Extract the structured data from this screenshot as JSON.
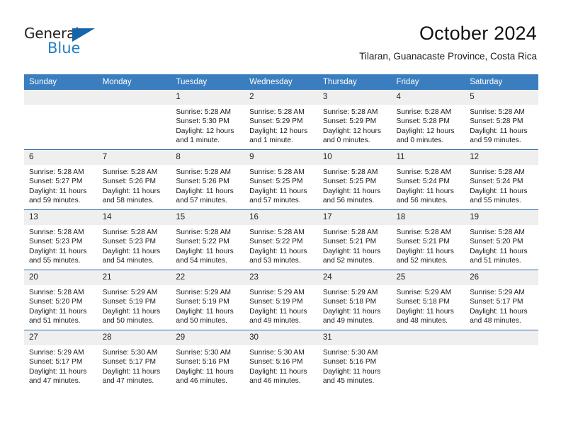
{
  "brand": {
    "name_dark": "General",
    "name_blue": "Blue",
    "accent_color": "#1f7fc4",
    "triangle_color": "#1565a8"
  },
  "header": {
    "title": "October 2024",
    "subtitle": "Tilaran, Guanacaste Province, Costa Rica"
  },
  "calendar": {
    "header_bg": "#3a7ec0",
    "row_border": "#2a68ad",
    "daynum_bg": "#efefef",
    "weekdays": [
      "Sunday",
      "Monday",
      "Tuesday",
      "Wednesday",
      "Thursday",
      "Friday",
      "Saturday"
    ],
    "weeks": [
      [
        {
          "day": "",
          "lines": []
        },
        {
          "day": "",
          "lines": []
        },
        {
          "day": "1",
          "lines": [
            "Sunrise: 5:28 AM",
            "Sunset: 5:30 PM",
            "Daylight: 12 hours",
            "and 1 minute."
          ]
        },
        {
          "day": "2",
          "lines": [
            "Sunrise: 5:28 AM",
            "Sunset: 5:29 PM",
            "Daylight: 12 hours",
            "and 1 minute."
          ]
        },
        {
          "day": "3",
          "lines": [
            "Sunrise: 5:28 AM",
            "Sunset: 5:29 PM",
            "Daylight: 12 hours",
            "and 0 minutes."
          ]
        },
        {
          "day": "4",
          "lines": [
            "Sunrise: 5:28 AM",
            "Sunset: 5:28 PM",
            "Daylight: 12 hours",
            "and 0 minutes."
          ]
        },
        {
          "day": "5",
          "lines": [
            "Sunrise: 5:28 AM",
            "Sunset: 5:28 PM",
            "Daylight: 11 hours",
            "and 59 minutes."
          ]
        }
      ],
      [
        {
          "day": "6",
          "lines": [
            "Sunrise: 5:28 AM",
            "Sunset: 5:27 PM",
            "Daylight: 11 hours",
            "and 59 minutes."
          ]
        },
        {
          "day": "7",
          "lines": [
            "Sunrise: 5:28 AM",
            "Sunset: 5:26 PM",
            "Daylight: 11 hours",
            "and 58 minutes."
          ]
        },
        {
          "day": "8",
          "lines": [
            "Sunrise: 5:28 AM",
            "Sunset: 5:26 PM",
            "Daylight: 11 hours",
            "and 57 minutes."
          ]
        },
        {
          "day": "9",
          "lines": [
            "Sunrise: 5:28 AM",
            "Sunset: 5:25 PM",
            "Daylight: 11 hours",
            "and 57 minutes."
          ]
        },
        {
          "day": "10",
          "lines": [
            "Sunrise: 5:28 AM",
            "Sunset: 5:25 PM",
            "Daylight: 11 hours",
            "and 56 minutes."
          ]
        },
        {
          "day": "11",
          "lines": [
            "Sunrise: 5:28 AM",
            "Sunset: 5:24 PM",
            "Daylight: 11 hours",
            "and 56 minutes."
          ]
        },
        {
          "day": "12",
          "lines": [
            "Sunrise: 5:28 AM",
            "Sunset: 5:24 PM",
            "Daylight: 11 hours",
            "and 55 minutes."
          ]
        }
      ],
      [
        {
          "day": "13",
          "lines": [
            "Sunrise: 5:28 AM",
            "Sunset: 5:23 PM",
            "Daylight: 11 hours",
            "and 55 minutes."
          ]
        },
        {
          "day": "14",
          "lines": [
            "Sunrise: 5:28 AM",
            "Sunset: 5:23 PM",
            "Daylight: 11 hours",
            "and 54 minutes."
          ]
        },
        {
          "day": "15",
          "lines": [
            "Sunrise: 5:28 AM",
            "Sunset: 5:22 PM",
            "Daylight: 11 hours",
            "and 54 minutes."
          ]
        },
        {
          "day": "16",
          "lines": [
            "Sunrise: 5:28 AM",
            "Sunset: 5:22 PM",
            "Daylight: 11 hours",
            "and 53 minutes."
          ]
        },
        {
          "day": "17",
          "lines": [
            "Sunrise: 5:28 AM",
            "Sunset: 5:21 PM",
            "Daylight: 11 hours",
            "and 52 minutes."
          ]
        },
        {
          "day": "18",
          "lines": [
            "Sunrise: 5:28 AM",
            "Sunset: 5:21 PM",
            "Daylight: 11 hours",
            "and 52 minutes."
          ]
        },
        {
          "day": "19",
          "lines": [
            "Sunrise: 5:28 AM",
            "Sunset: 5:20 PM",
            "Daylight: 11 hours",
            "and 51 minutes."
          ]
        }
      ],
      [
        {
          "day": "20",
          "lines": [
            "Sunrise: 5:28 AM",
            "Sunset: 5:20 PM",
            "Daylight: 11 hours",
            "and 51 minutes."
          ]
        },
        {
          "day": "21",
          "lines": [
            "Sunrise: 5:29 AM",
            "Sunset: 5:19 PM",
            "Daylight: 11 hours",
            "and 50 minutes."
          ]
        },
        {
          "day": "22",
          "lines": [
            "Sunrise: 5:29 AM",
            "Sunset: 5:19 PM",
            "Daylight: 11 hours",
            "and 50 minutes."
          ]
        },
        {
          "day": "23",
          "lines": [
            "Sunrise: 5:29 AM",
            "Sunset: 5:19 PM",
            "Daylight: 11 hours",
            "and 49 minutes."
          ]
        },
        {
          "day": "24",
          "lines": [
            "Sunrise: 5:29 AM",
            "Sunset: 5:18 PM",
            "Daylight: 11 hours",
            "and 49 minutes."
          ]
        },
        {
          "day": "25",
          "lines": [
            "Sunrise: 5:29 AM",
            "Sunset: 5:18 PM",
            "Daylight: 11 hours",
            "and 48 minutes."
          ]
        },
        {
          "day": "26",
          "lines": [
            "Sunrise: 5:29 AM",
            "Sunset: 5:17 PM",
            "Daylight: 11 hours",
            "and 48 minutes."
          ]
        }
      ],
      [
        {
          "day": "27",
          "lines": [
            "Sunrise: 5:29 AM",
            "Sunset: 5:17 PM",
            "Daylight: 11 hours",
            "and 47 minutes."
          ]
        },
        {
          "day": "28",
          "lines": [
            "Sunrise: 5:30 AM",
            "Sunset: 5:17 PM",
            "Daylight: 11 hours",
            "and 47 minutes."
          ]
        },
        {
          "day": "29",
          "lines": [
            "Sunrise: 5:30 AM",
            "Sunset: 5:16 PM",
            "Daylight: 11 hours",
            "and 46 minutes."
          ]
        },
        {
          "day": "30",
          "lines": [
            "Sunrise: 5:30 AM",
            "Sunset: 5:16 PM",
            "Daylight: 11 hours",
            "and 46 minutes."
          ]
        },
        {
          "day": "31",
          "lines": [
            "Sunrise: 5:30 AM",
            "Sunset: 5:16 PM",
            "Daylight: 11 hours",
            "and 45 minutes."
          ]
        },
        {
          "day": "",
          "lines": []
        },
        {
          "day": "",
          "lines": []
        }
      ]
    ]
  }
}
